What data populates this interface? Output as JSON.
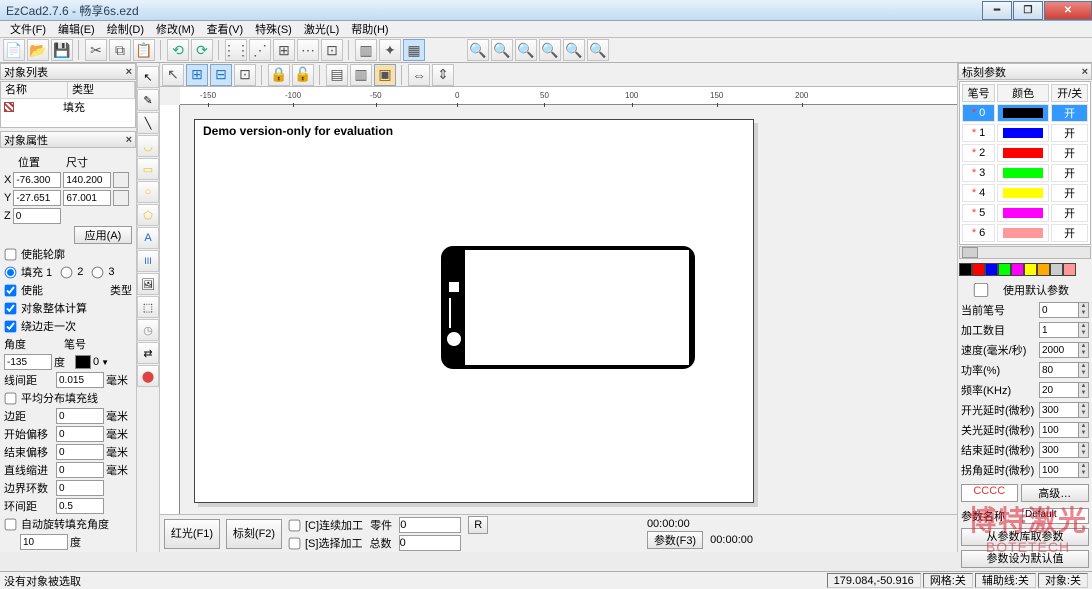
{
  "window": {
    "title": "EzCad2.7.6 - 畅享6s.ezd"
  },
  "menu": [
    "文件(F)",
    "编辑(E)",
    "绘制(D)",
    "修改(M)",
    "查看(V)",
    "特殊(S)",
    "激光(L)",
    "帮助(H)"
  ],
  "objectList": {
    "title": "对象列表",
    "cols": [
      "名称",
      "类型"
    ],
    "rows": [
      {
        "name": "",
        "type": "填充"
      }
    ]
  },
  "objectProp": {
    "title": "对象属性",
    "posLabel": "位置",
    "sizeLabel": "尺寸",
    "x": "-76.300",
    "w": "140.200",
    "y": "-27.651",
    "h": "67.001",
    "z": "0",
    "apply": "应用(A)",
    "enableOutline": "使能轮廓",
    "hatch1": "填充 1",
    "hatch2": "2",
    "hatch3": "3",
    "enable": "使能",
    "typeLabel": "类型",
    "wholeCalc": "对象整体计算",
    "edgeOnce": "绕边走一次",
    "angleLabel": "角度",
    "penLabel": "笔号",
    "angle": "-135",
    "du": "度",
    "penColor": "#000000",
    "penNum": "0",
    "lineDistLabel": "线间距",
    "lineDist": "0.015",
    "mm": "毫米",
    "avgFill": "平均分布填充线",
    "edgeDistLabel": "边距",
    "edgeDist": "0",
    "startOffLabel": "开始偏移",
    "startOff": "0",
    "endOffLabel": "结束偏移",
    "endOff": "0",
    "lineReduceLabel": "直线缩进",
    "lineReduce": "0",
    "loopsLabel": "边界环数",
    "loops": "0",
    "ringDistLabel": "环间距",
    "ringDist": "0.5",
    "autoRotate": "自动旋转填充角度",
    "autoRotateVal": "10"
  },
  "canvas": {
    "watermark": "Demo version-only for evaluation"
  },
  "bottom": {
    "red": "红光(F1)",
    "mark": "标刻(F2)",
    "cont": "[C]连续加工",
    "sel": "[S]选择加工",
    "partLabel": "零件",
    "partVal": "0",
    "r": "R",
    "totalLabel": "总数",
    "totalVal": "0",
    "time1": "00:00:00",
    "param": "参数(F3)",
    "time2": "00:00:00"
  },
  "markParam": {
    "title": "标刻参数",
    "cols": [
      "笔号",
      "颜色",
      "开/关"
    ],
    "onText": "开",
    "penColors": [
      "#000000",
      "#0000ff",
      "#ff0000",
      "#00ff00",
      "#ffff00",
      "#ff00ff",
      "#ff9999"
    ],
    "palette": [
      "#000000",
      "#ff0000",
      "#0000ff",
      "#00ff00",
      "#ff00ff",
      "#ffff00",
      "#ffaa00",
      "#cccccc",
      "#ff9999"
    ],
    "useDefault": "使用默认参数",
    "curPen": "当前笔号",
    "curPenV": "0",
    "procCount": "加工数目",
    "procCountV": "1",
    "speed": "速度(毫米/秒)",
    "speedV": "2000",
    "power": "功率(%)",
    "powerV": "80",
    "freq": "频率(KHz)",
    "freqV": "20",
    "onDelay": "开光延时(微秒)",
    "onDelayV": "300",
    "offDelay": "关光延时(微秒)",
    "offDelayV": "100",
    "endDelay": "结束延时(微秒)",
    "endDelayV": "300",
    "cornerDelay": "拐角延时(微秒)",
    "cornerDelayV": "100",
    "advanced": "高级…",
    "paramName": "参数名称",
    "paramNameV": "Default",
    "fromLib": "从参数库取参数",
    "setDefault": "参数设为默认值"
  },
  "status": {
    "msg": "没有对象被选取",
    "coord": "179.084,-50.916",
    "grid": "网格:关",
    "guide": "辅助线:关",
    "obj": "对象:关"
  },
  "brand": {
    "cn": "博特激光",
    "en": "BOTETECH"
  },
  "rulerTicks": [
    "-150",
    "-100",
    "-50",
    "0",
    "50",
    "100",
    "150",
    "200"
  ]
}
